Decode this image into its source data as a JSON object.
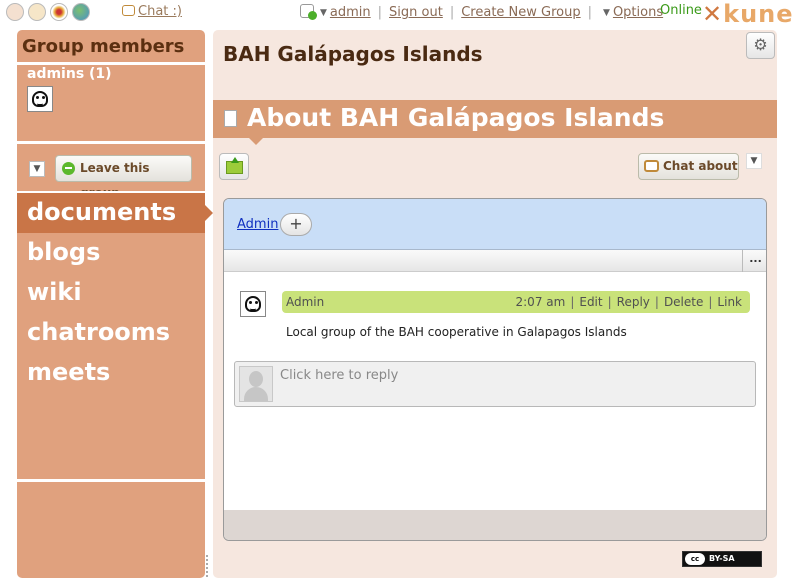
{
  "topbar": {
    "chat_label": "Chat :)",
    "user": "admin",
    "sign_out": "Sign out",
    "create_group": "Create New Group",
    "options": "Options",
    "online": "Online",
    "logo": "kune"
  },
  "sidebar": {
    "title": "Group members",
    "members_heading": "admins (1)",
    "leave_button": "Leave this group",
    "tools": [
      {
        "label": "documents"
      },
      {
        "label": "blogs"
      },
      {
        "label": "wiki"
      },
      {
        "label": "chatrooms"
      },
      {
        "label": "meets"
      }
    ]
  },
  "main": {
    "group_title": "BAH Galápagos Islands",
    "doc_title": "About BAH Galápagos Islands",
    "chat_about": "Chat about",
    "wave": {
      "participant": "Admin",
      "add_symbol": "+",
      "more_symbol": "...",
      "blip": {
        "author": "Admin",
        "time": "2:07 am",
        "actions": [
          "Edit",
          "Reply",
          "Delete",
          "Link"
        ],
        "text": "Local group of the BAH cooperative in Galapagos Islands"
      },
      "reply_placeholder": "Click here to reply"
    },
    "license": "BY-SA",
    "license_badge": "cc"
  },
  "colors": {
    "sidebar_bg": "#e0a17e",
    "active_tool": "#c97547",
    "title_bar": "#d99b74",
    "main_bg": "#f6e7df",
    "wave_header": "#c9def7",
    "blip_header": "#c9e27a"
  }
}
